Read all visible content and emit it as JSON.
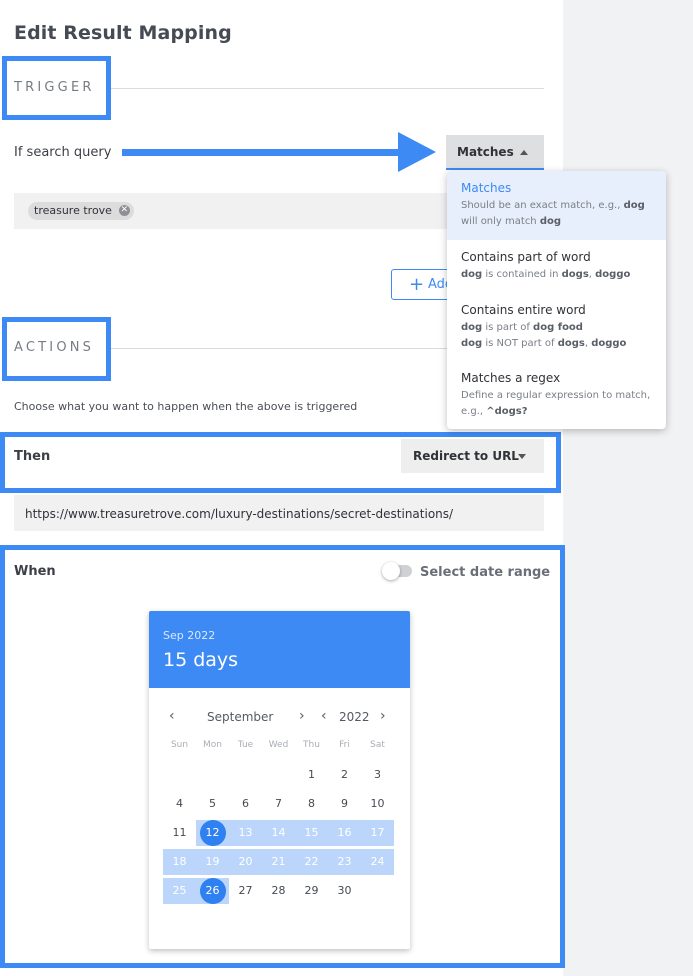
{
  "page_title": "Edit Result Mapping",
  "trigger": {
    "section_label": "TRIGGER",
    "query_label": "If search query",
    "match_select": "Matches",
    "tags": [
      {
        "label": "treasure trove"
      }
    ],
    "add_button": "Add"
  },
  "match_dropdown": {
    "options": [
      {
        "title": "Matches",
        "desc_lines": [
          "Should be an exact match, e.g., dog",
          "will only match dog"
        ],
        "selected": true
      },
      {
        "title": "Contains part of word",
        "desc_lines": [
          "dog is contained in dogs, doggo"
        ],
        "selected": false
      },
      {
        "title": "Contains entire word",
        "desc_lines": [
          "dog is part of dog food",
          "dog is NOT part of dogs, doggo"
        ],
        "selected": false
      },
      {
        "title": "Matches a regex",
        "desc_lines": [
          "Define a regular expression to match,",
          "e.g., ^dogs?"
        ],
        "selected": false
      }
    ]
  },
  "actions": {
    "section_label": "ACTIONS",
    "description": "Choose what you want to happen when the above is triggered",
    "then_label": "Then",
    "then_select": "Redirect to URL",
    "url_value": "https://www.treasuretrove.com/luxury-destinations/secret-destinations/"
  },
  "when": {
    "label": "When",
    "date_range_toggle_label": "Select date range",
    "date_range_enabled": false
  },
  "calendar": {
    "header_sub": "Sep 2022",
    "header_main": "15 days",
    "month": "September",
    "year": "2022",
    "prev_icon": "chevron-left-icon",
    "next_icon": "chevron-right-icon",
    "weekdays": [
      "Sun",
      "Mon",
      "Tue",
      "Wed",
      "Thu",
      "Fri",
      "Sat"
    ],
    "first_weekday_index": 4,
    "days_in_month": 30,
    "range_start": 12,
    "range_end": 26
  },
  "colors": {
    "accent": "#3d8af5",
    "range_fill": "#bcd5fb",
    "selected_day": "#2f80f0",
    "annotation_box": "#3d8af5"
  }
}
